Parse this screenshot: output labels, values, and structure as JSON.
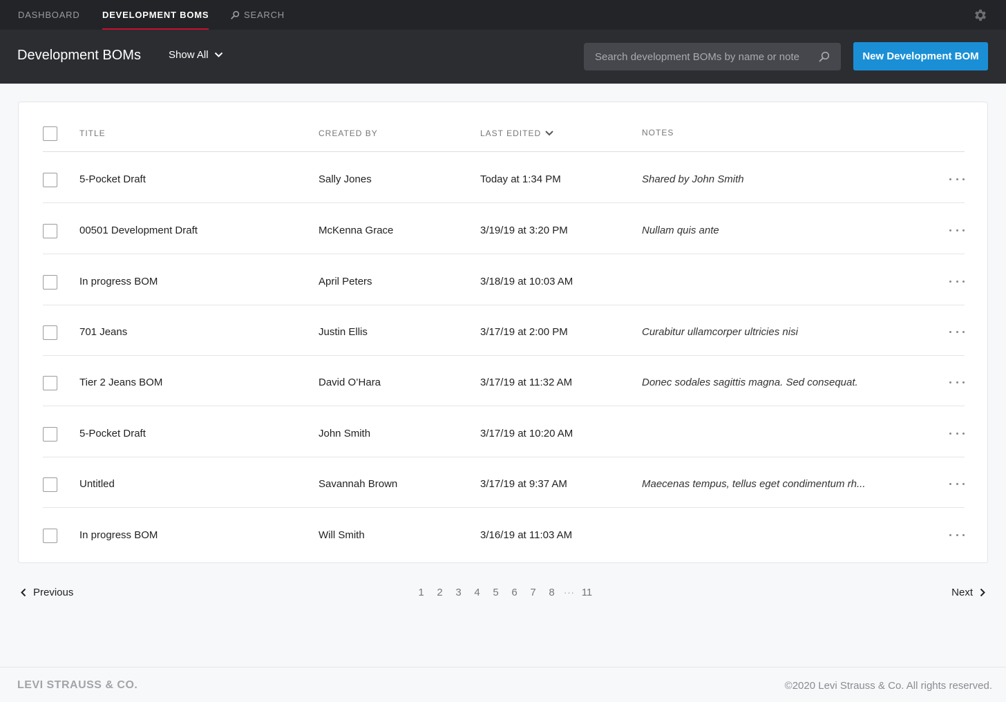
{
  "topnav": {
    "items": [
      {
        "label": "DASHBOARD"
      },
      {
        "label": "DEVELOPMENT BOMs"
      },
      {
        "label": "SEARCH"
      }
    ]
  },
  "header": {
    "title": "Development BOMs",
    "filter_label": "Show All",
    "search_placeholder": "Search development BOMs by name or note",
    "new_button_label": "New Development BOM"
  },
  "table": {
    "columns": {
      "title": "TITLE",
      "created_by": "CREATED BY",
      "last_edited": "LAST EDITED",
      "notes": "NOTES"
    },
    "rows": [
      {
        "title": "5-Pocket Draft",
        "created_by": "Sally Jones",
        "last_edited": "Today at 1:34 PM",
        "notes": "Shared by John Smith"
      },
      {
        "title": "00501 Development Draft",
        "created_by": "McKenna Grace",
        "last_edited": "3/19/19 at 3:20 PM",
        "notes": "Nullam quis ante"
      },
      {
        "title": "In progress BOM",
        "created_by": "April Peters",
        "last_edited": "3/18/19 at 10:03 AM",
        "notes": ""
      },
      {
        "title": "701 Jeans",
        "created_by": "Justin Ellis",
        "last_edited": "3/17/19 at 2:00 PM",
        "notes": "Curabitur ullamcorper ultricies nisi"
      },
      {
        "title": "Tier 2 Jeans BOM",
        "created_by": "David O’Hara",
        "last_edited": "3/17/19 at 11:32 AM",
        "notes": "Donec sodales sagittis magna. Sed consequat."
      },
      {
        "title": "5-Pocket Draft",
        "created_by": "John Smith",
        "last_edited": "3/17/19 at 10:20 AM",
        "notes": ""
      },
      {
        "title": "Untitled",
        "created_by": "Savannah Brown",
        "last_edited": "3/17/19 at 9:37 AM",
        "notes": "Maecenas tempus, tellus eget condimentum rh..."
      },
      {
        "title": "In progress BOM",
        "created_by": "Will Smith",
        "last_edited": "3/16/19 at 11:03 AM",
        "notes": ""
      }
    ]
  },
  "pagination": {
    "prev_label": "Previous",
    "next_label": "Next",
    "pages": [
      "1",
      "2",
      "3",
      "4",
      "5",
      "6",
      "7",
      "8"
    ],
    "ellipsis": "···",
    "last_page": "11"
  },
  "footer": {
    "logo": "LEVI STRAUSS & CO.",
    "copyright": "©2020 Levi Strauss & Co. All rights reserved."
  },
  "colors": {
    "topnav_bg": "#232427",
    "header_bg": "#2c2d31",
    "accent_red": "#c8102e",
    "primary_blue": "#1a8fd6"
  },
  "icons": [
    "search-icon",
    "gear-icon",
    "chevron-down-icon",
    "chevron-left-icon",
    "chevron-right-icon",
    "more-icon"
  ]
}
